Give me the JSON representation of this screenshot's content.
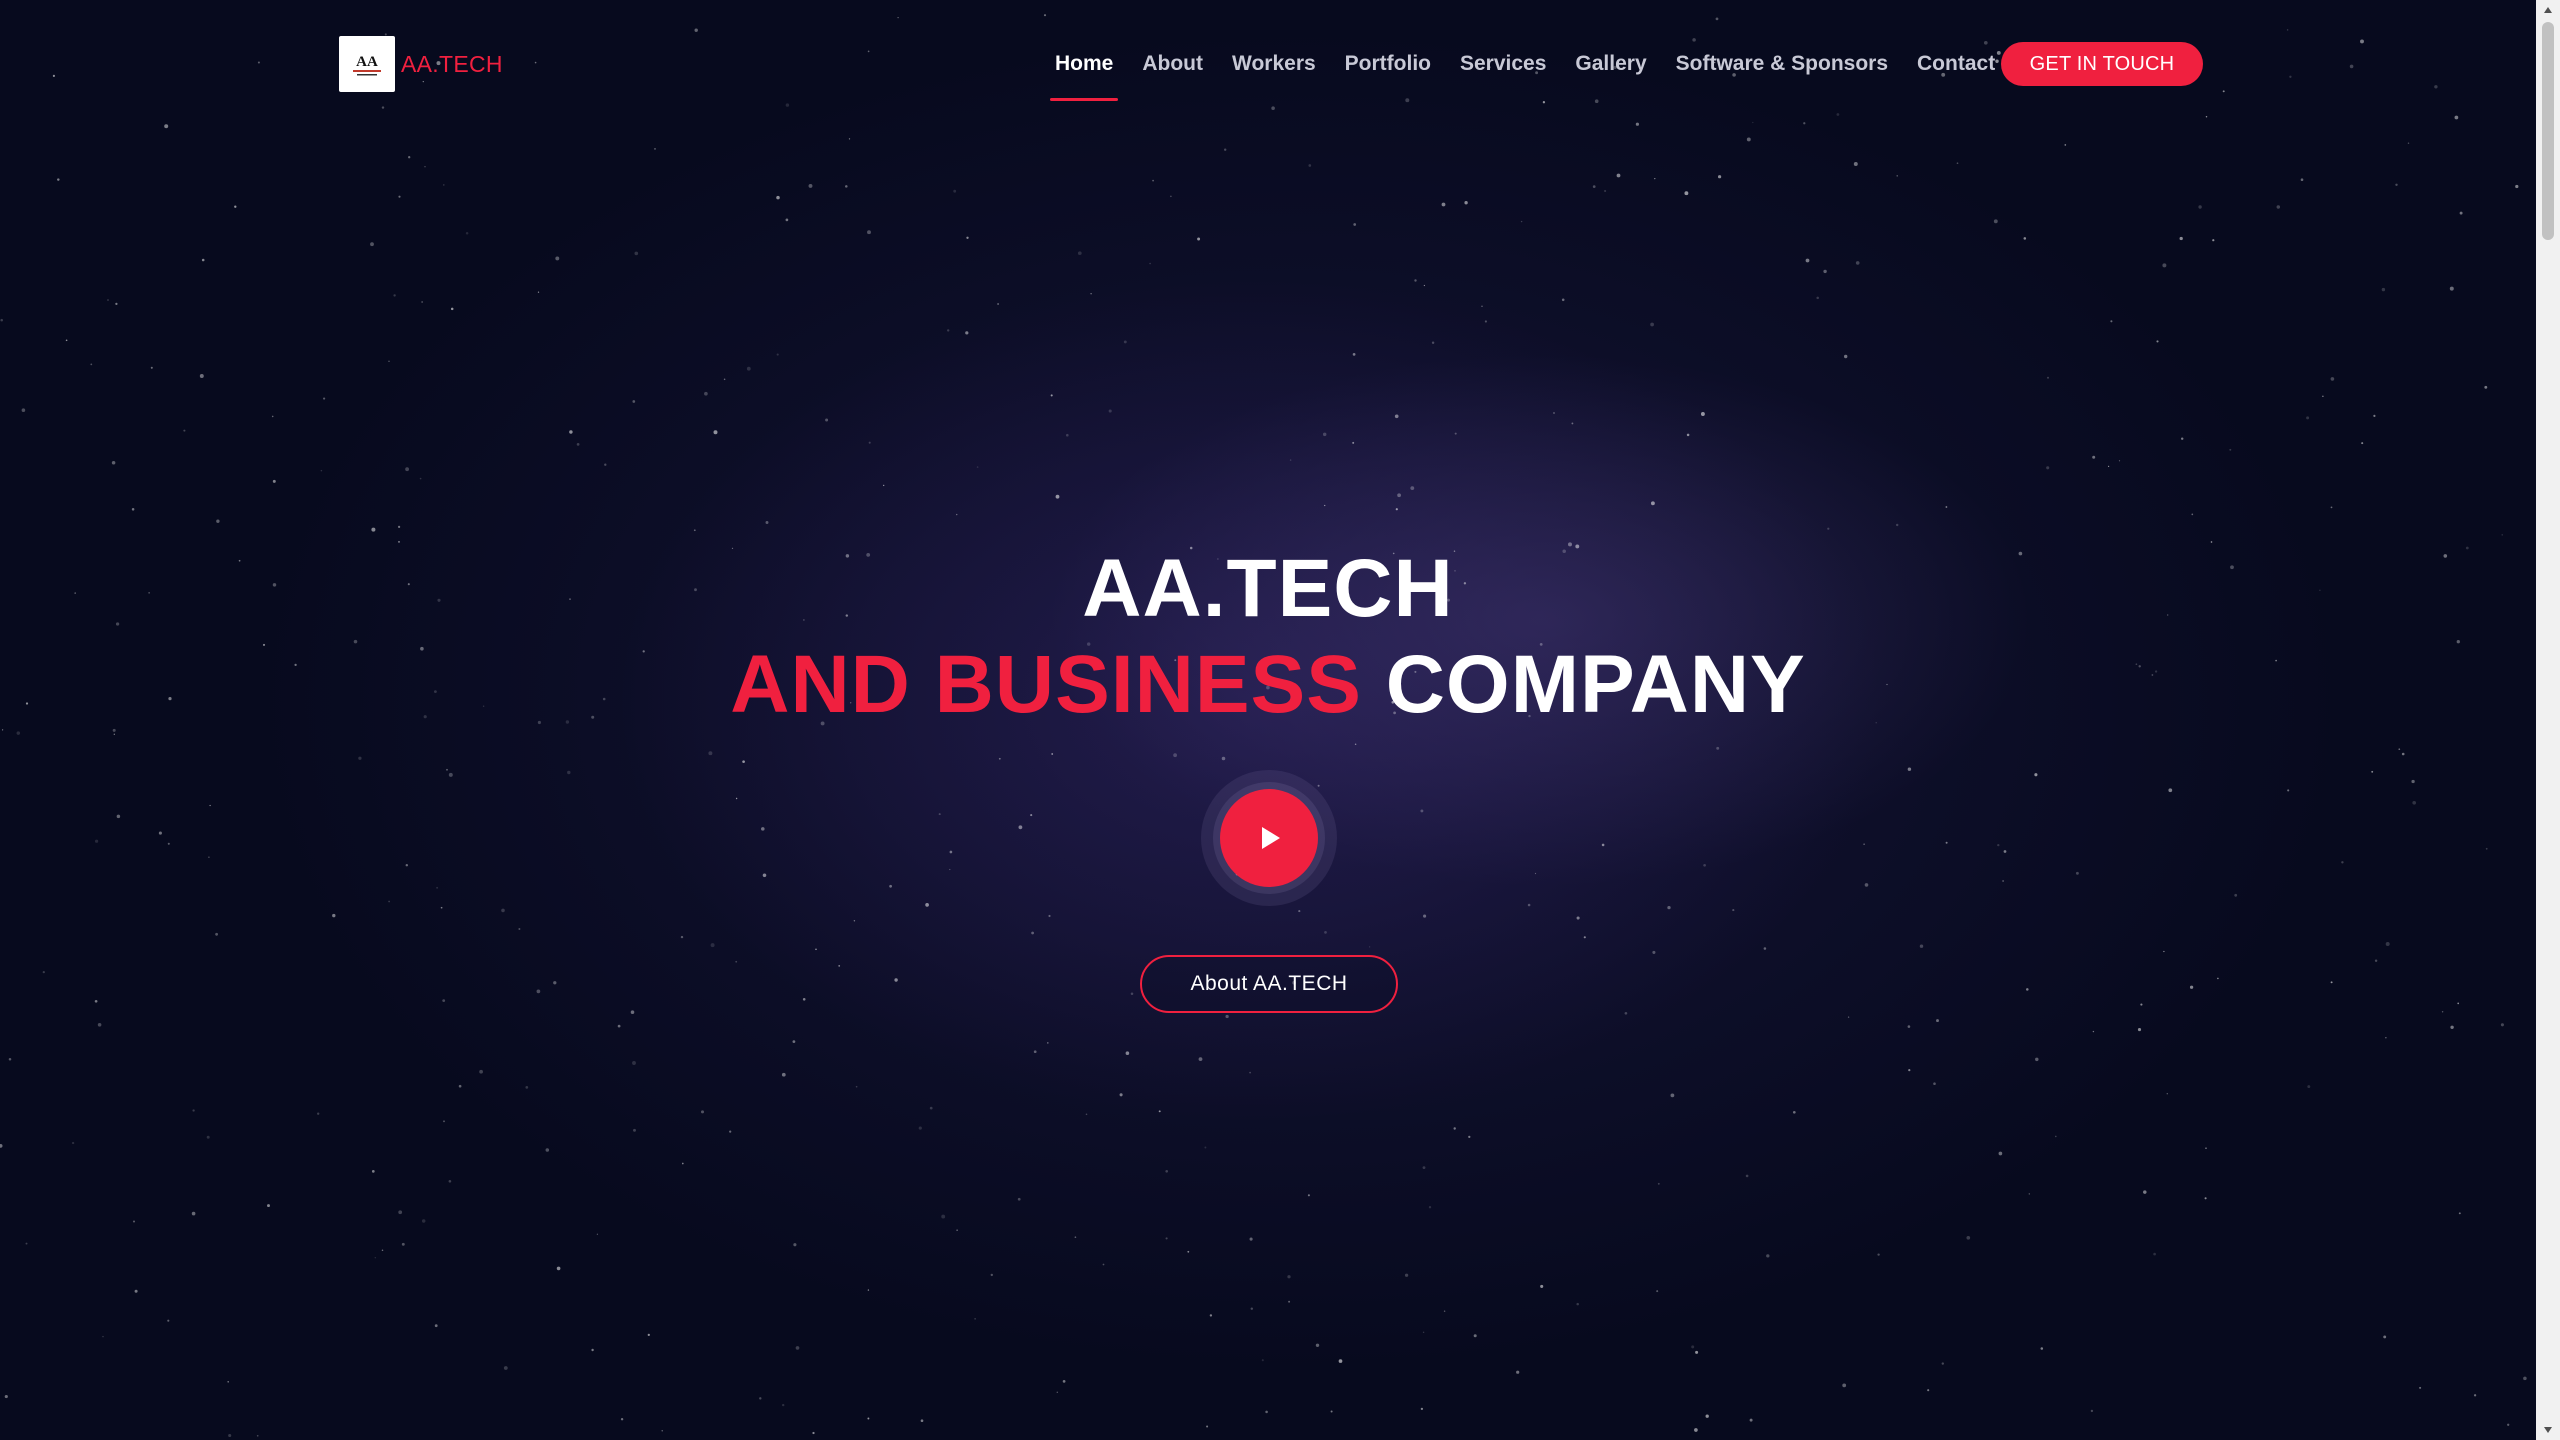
{
  "header": {
    "logo_text": "AA.TECH",
    "logo_badge": "AA",
    "nav": [
      {
        "label": "Home",
        "active": true
      },
      {
        "label": "About"
      },
      {
        "label": "Workers"
      },
      {
        "label": "Portfolio"
      },
      {
        "label": "Services"
      },
      {
        "label": "Gallery"
      },
      {
        "label": "Software & Sponsors"
      },
      {
        "label": "Contact"
      }
    ],
    "cta_label": "GET IN TOUCH"
  },
  "hero": {
    "title_line1": "AA.TECH",
    "title_line2_highlight": "AND BUSINESS",
    "title_line2_rest": "COMPANY",
    "play_icon": "play-icon",
    "about_button_label": "About AA.TECH"
  },
  "colors": {
    "accent": "#f0203f",
    "background": "#070a1e",
    "nav_text": "#c8c9d6",
    "text": "#ffffff"
  }
}
